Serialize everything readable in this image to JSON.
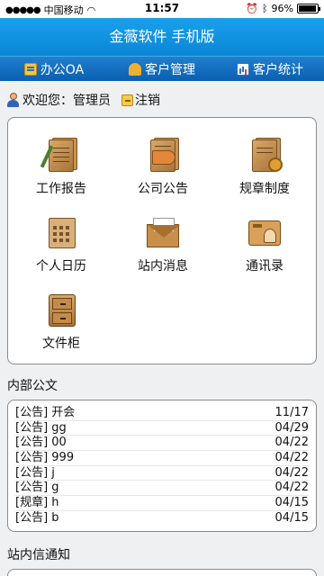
{
  "statusbar": {
    "carrier": "中国移动",
    "time": "11:57",
    "battery_label": "96%",
    "battery_level": 0.96
  },
  "app": {
    "title": "金薇软件 手机版"
  },
  "nav": {
    "items": [
      {
        "label": "办公OA",
        "icon": "oa-icon"
      },
      {
        "label": "客户管理",
        "icon": "customer-icon"
      },
      {
        "label": "客户统计",
        "icon": "stats-icon"
      }
    ]
  },
  "welcome": {
    "text": "欢迎您：管理员",
    "logout": "注销"
  },
  "modules": [
    {
      "label": "工作报告",
      "icon": "work-report-icon"
    },
    {
      "label": "公司公告",
      "icon": "announcement-icon"
    },
    {
      "label": "规章制度",
      "icon": "rules-icon"
    },
    {
      "label": "个人日历",
      "icon": "calendar-icon"
    },
    {
      "label": "站内消息",
      "icon": "message-icon"
    },
    {
      "label": "通讯录",
      "icon": "contacts-icon"
    },
    {
      "label": "文件柜",
      "icon": "file-cabinet-icon"
    }
  ],
  "internal_docs": {
    "title": "内部公文",
    "rows": [
      {
        "title": "[公告] 开会",
        "date": "11/17"
      },
      {
        "title": "[公告] gg",
        "date": "04/29"
      },
      {
        "title": "[公告] 00",
        "date": "04/22"
      },
      {
        "title": "[公告] 999",
        "date": "04/22"
      },
      {
        "title": "[公告] j",
        "date": "04/22"
      },
      {
        "title": "[公告] g",
        "date": "04/22"
      },
      {
        "title": "[规章] h",
        "date": "04/15"
      },
      {
        "title": "[公告] b",
        "date": "04/15"
      }
    ]
  },
  "notices": {
    "title": "站内信通知"
  }
}
